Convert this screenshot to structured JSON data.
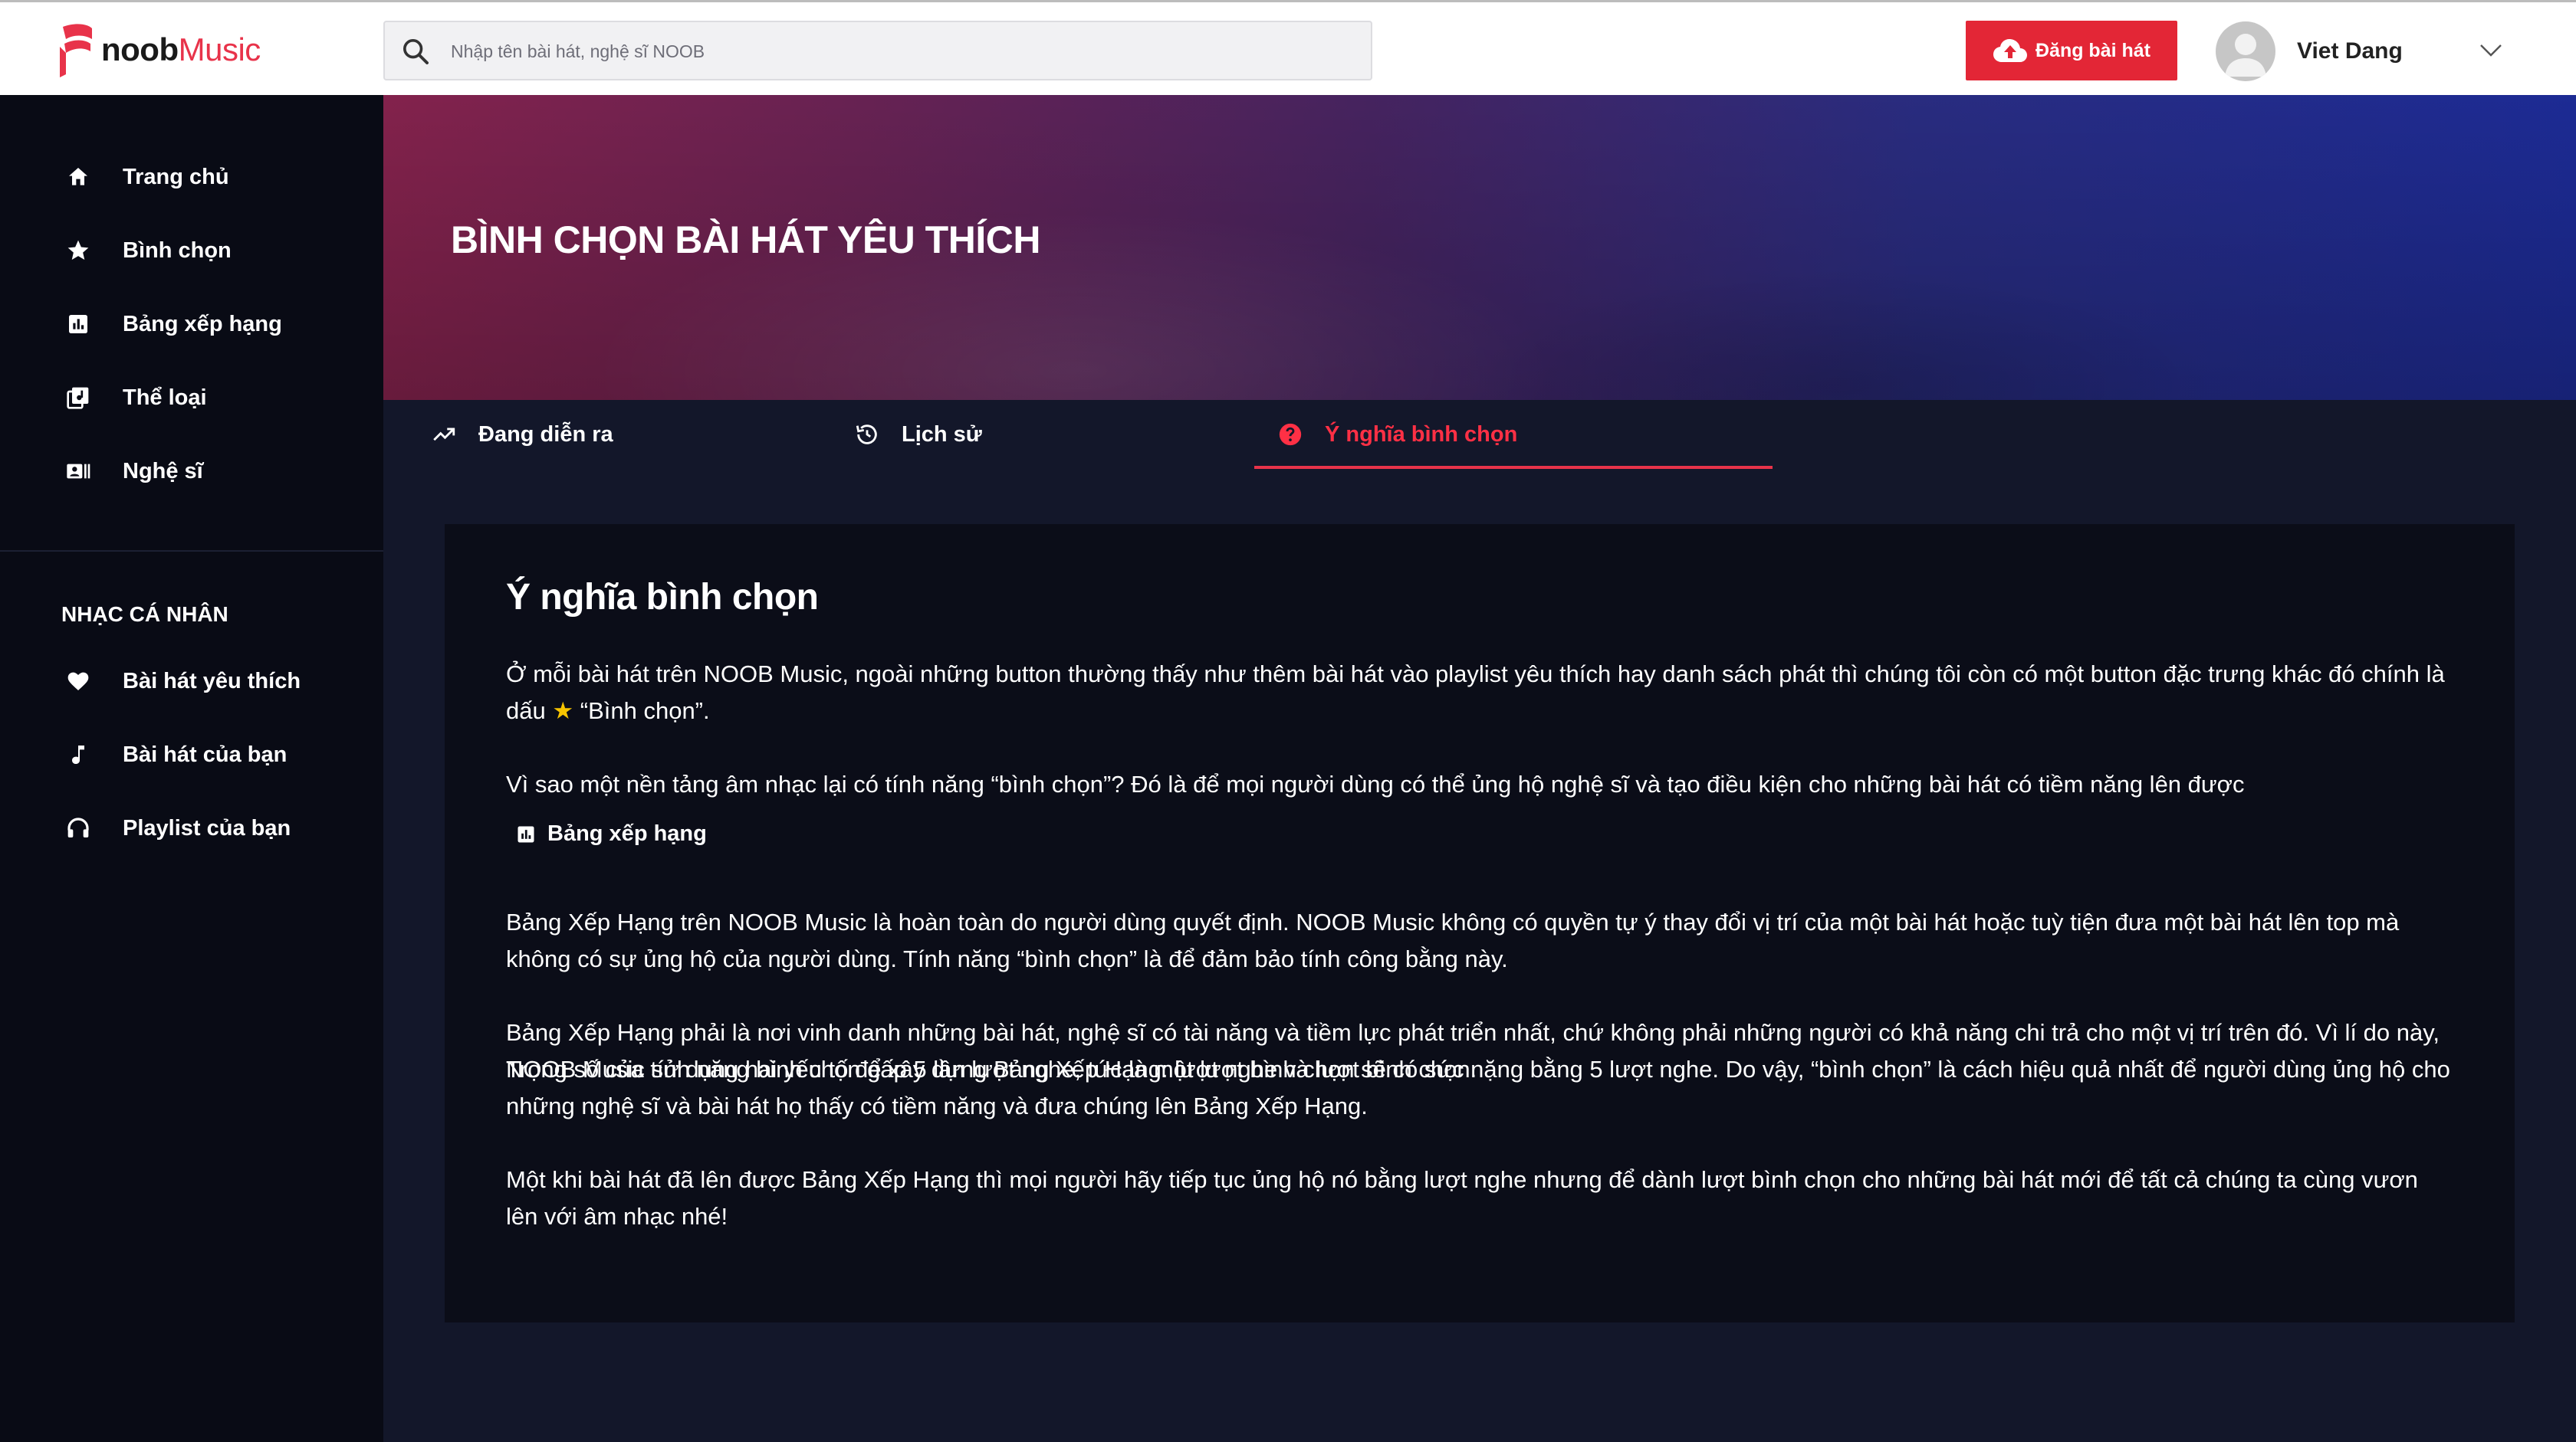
{
  "brand": {
    "name_bold": "noob",
    "name_light": "Music",
    "accent": "#e8334a"
  },
  "search": {
    "placeholder": "Nhập tên bài hát, nghệ sĩ NOOB"
  },
  "header": {
    "upload_label": "Đăng bài hát",
    "user_name": "Viet Dang"
  },
  "sidebar": {
    "items": [
      {
        "label": "Trang chủ",
        "icon": "home-icon"
      },
      {
        "label": "Bình chọn",
        "icon": "star-icon"
      },
      {
        "label": "Bảng xếp hạng",
        "icon": "chart-icon"
      },
      {
        "label": "Thể loại",
        "icon": "library-icon"
      },
      {
        "label": "Nghệ sĩ",
        "icon": "artist-icon"
      }
    ],
    "section_title": "NHẠC CÁ NHÂN",
    "personal": [
      {
        "label": "Bài hát yêu thích",
        "icon": "heart-icon"
      },
      {
        "label": "Bài hát của bạn",
        "icon": "music-note-icon"
      },
      {
        "label": "Playlist của bạn",
        "icon": "headphones-icon"
      }
    ]
  },
  "banner": {
    "title": "BÌNH CHỌN BÀI HÁT YÊU THÍCH"
  },
  "tabs": [
    {
      "label": "Đang diễn ra",
      "icon": "trending-icon",
      "active": false
    },
    {
      "label": "Lịch sử",
      "icon": "history-icon",
      "active": false
    },
    {
      "label": "Ý nghĩa bình chọn",
      "icon": "help-icon",
      "active": true
    }
  ],
  "content": {
    "title": "Ý nghĩa bình chọn",
    "p1_before": "Ở mỗi bài hát trên NOOB Music, ngoài những button thường thấy như thêm bài hát vào playlist yêu thích hay danh sách phát thì chúng tôi còn có một button đặc trưng khác đó chính là dấu ",
    "p1_star": "★",
    "p1_after": " “Bình chọn”.",
    "p2": "Vì sao một nền tảng âm nhạc lại có tính năng “bình chọn”? Đó là để mọi người dùng có thể ủng hộ nghệ sĩ và tạo điều kiện cho những bài hát có tiềm năng lên được",
    "chart_link": "Bảng xếp hạng",
    "p3": "Bảng Xếp Hạng trên NOOB Music là hoàn toàn do người dùng quyết định. NOOB Music không có quyền tự ý thay đổi vị trí của một bài hát hoặc tuỳ tiện đưa một bài hát lên top mà không có sự ủng hộ của người dùng. Tính năng “bình chọn” là để đảm bảo tính công bằng này.",
    "p4": "Bảng Xếp Hạng phải là nơi vinh danh những bài hát, nghệ sĩ có tài năng và tiềm lực phát triển nhất, chứ không phải những người có khả năng chi trả cho một vị trí trên đó. Vì lí do này, NOOB Music sử dụng hai yếu tố để xây dựng Bảng Xếp Hạng: lượt nghe và lượt bình chọn.",
    "p5": "Trọng số của tính năng bình chọn gấp 5 lần lượt nghe, tức là một lượt bình chọn sẽ có sức nặng bằng 5 lượt nghe. Do vậy, “bình chọn” là cách hiệu quả nhất để người dùng ủng hộ cho những nghệ sĩ và bài hát họ thấy có tiềm năng và đưa chúng lên Bảng Xếp Hạng.",
    "p6": "Một khi bài hát đã lên được Bảng Xếp Hạng thì mọi người hãy tiếp tục ủng hộ nó bằng lượt nghe nhưng để dành lượt bình chọn cho những bài hát mới để tất cả chúng ta cùng vươn lên với âm nhạc nhé!"
  }
}
